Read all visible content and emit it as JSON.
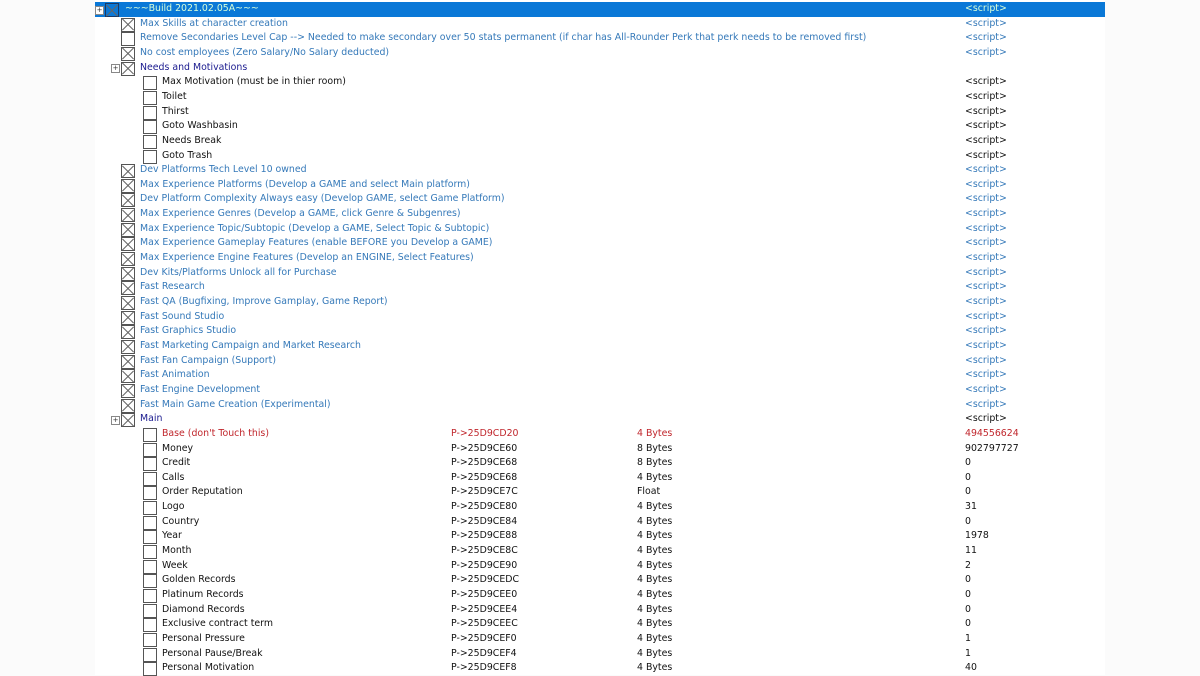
{
  "colors": {
    "selection": "#0a78d7",
    "script": "#3579b9",
    "group": "#1b1b8f",
    "red": "#c0262c"
  },
  "rows": [
    {
      "level": 0,
      "expander": true,
      "checked": true,
      "label": "~~~Build 2021.02.05A~~~",
      "value": "<script>",
      "style": "script",
      "selected": true
    },
    {
      "level": 1,
      "checked": true,
      "label": "Max Skills at character creation",
      "value": "<script>",
      "style": "script"
    },
    {
      "level": 1,
      "checked": false,
      "label": "Remove Secondaries Level Cap --> Needed to make secondary over 50 stats permanent (if char has All-Rounder Perk that perk needs to be removed first)",
      "value": "<script>",
      "style": "script"
    },
    {
      "level": 1,
      "checked": true,
      "label": "No cost employees (Zero Salary/No Salary deducted)",
      "value": "<script>",
      "style": "script"
    },
    {
      "level": 1,
      "expander": true,
      "checked": true,
      "label": "Needs and Motivations",
      "value": "",
      "style": "group"
    },
    {
      "level": 2,
      "checked": false,
      "label": "Max Motivation (must be in thier room)",
      "value": "<script>",
      "style": "plain"
    },
    {
      "level": 2,
      "checked": false,
      "label": "Toilet",
      "value": "<script>",
      "style": "plain"
    },
    {
      "level": 2,
      "checked": false,
      "label": "Thirst",
      "value": "<script>",
      "style": "plain"
    },
    {
      "level": 2,
      "checked": false,
      "label": "Goto Washbasin",
      "value": "<script>",
      "style": "plain"
    },
    {
      "level": 2,
      "checked": false,
      "label": "Needs Break",
      "value": "<script>",
      "style": "plain"
    },
    {
      "level": 2,
      "checked": false,
      "label": "Goto Trash",
      "value": "<script>",
      "style": "plain"
    },
    {
      "level": 1,
      "checked": true,
      "label": "Dev Platforms Tech Level 10 owned",
      "value": "<script>",
      "style": "script"
    },
    {
      "level": 1,
      "checked": true,
      "label": "Max Experience Platforms  (Develop a GAME and select Main platform)",
      "value": "<script>",
      "style": "script"
    },
    {
      "level": 1,
      "checked": true,
      "label": "Dev Platform Complexity Always easy (Develop GAME, select Game Platform)",
      "value": "<script>",
      "style": "script"
    },
    {
      "level": 1,
      "checked": true,
      "label": "Max Experience Genres (Develop a GAME, click Genre & Subgenres)",
      "value": "<script>",
      "style": "script"
    },
    {
      "level": 1,
      "checked": true,
      "label": "Max Experience Topic/Subtopic (Develop a GAME, Select Topic & Subtopic)",
      "value": "<script>",
      "style": "script"
    },
    {
      "level": 1,
      "checked": true,
      "label": "Max Experience Gameplay Features (enable BEFORE you Develop a GAME)",
      "value": "<script>",
      "style": "script"
    },
    {
      "level": 1,
      "checked": true,
      "label": "Max Experience Engine Features (Develop an ENGINE, Select Features)",
      "value": "<script>",
      "style": "script"
    },
    {
      "level": 1,
      "checked": true,
      "label": "Dev Kits/Platforms Unlock all for Purchase",
      "value": "<script>",
      "style": "script"
    },
    {
      "level": 1,
      "checked": true,
      "label": "Fast Research",
      "value": "<script>",
      "style": "script"
    },
    {
      "level": 1,
      "checked": true,
      "label": "Fast QA (Bugfixing, Improve Gamplay, Game Report)",
      "value": "<script>",
      "style": "script"
    },
    {
      "level": 1,
      "checked": true,
      "label": "Fast Sound Studio",
      "value": "<script>",
      "style": "script"
    },
    {
      "level": 1,
      "checked": true,
      "label": "Fast Graphics Studio",
      "value": "<script>",
      "style": "script"
    },
    {
      "level": 1,
      "checked": true,
      "label": "Fast Marketing Campaign and Market Research",
      "value": "<script>",
      "style": "script"
    },
    {
      "level": 1,
      "checked": true,
      "label": "Fast Fan Campaign (Support)",
      "value": "<script>",
      "style": "script"
    },
    {
      "level": 1,
      "checked": true,
      "label": "Fast Animation",
      "value": "<script>",
      "style": "script"
    },
    {
      "level": 1,
      "checked": true,
      "label": "Fast Engine Development",
      "value": "<script>",
      "style": "script"
    },
    {
      "level": 1,
      "checked": true,
      "label": "Fast Main Game Creation (Experimental)",
      "value": "<script>",
      "style": "script"
    },
    {
      "level": 1,
      "expander": true,
      "checked": true,
      "label": "Main",
      "value": "<script>",
      "style": "group"
    },
    {
      "level": 2,
      "checked": false,
      "label": "Base (don't Touch this)",
      "address": "P->25D9CD20",
      "type": "4 Bytes",
      "value": "494556624",
      "style": "red"
    },
    {
      "level": 2,
      "checked": false,
      "label": "Money",
      "address": "P->25D9CE60",
      "type": "8 Bytes",
      "value": "902797727",
      "style": "plain"
    },
    {
      "level": 2,
      "checked": false,
      "label": "Credit",
      "address": "P->25D9CE68",
      "type": "8 Bytes",
      "value": "0",
      "style": "plain"
    },
    {
      "level": 2,
      "checked": false,
      "label": "Calls",
      "address": "P->25D9CE68",
      "type": "4 Bytes",
      "value": "0",
      "style": "plain"
    },
    {
      "level": 2,
      "checked": false,
      "label": "Order Reputation",
      "address": "P->25D9CE7C",
      "type": "Float",
      "value": "0",
      "style": "plain"
    },
    {
      "level": 2,
      "checked": false,
      "label": "Logo",
      "address": "P->25D9CE80",
      "type": "4 Bytes",
      "value": "31",
      "style": "plain"
    },
    {
      "level": 2,
      "checked": false,
      "label": "Country",
      "address": "P->25D9CE84",
      "type": "4 Bytes",
      "value": "0",
      "style": "plain"
    },
    {
      "level": 2,
      "checked": false,
      "label": "Year",
      "address": "P->25D9CE88",
      "type": "4 Bytes",
      "value": "1978",
      "style": "plain"
    },
    {
      "level": 2,
      "checked": false,
      "label": "Month",
      "address": "P->25D9CE8C",
      "type": "4 Bytes",
      "value": "11",
      "style": "plain"
    },
    {
      "level": 2,
      "checked": false,
      "label": "Week",
      "address": "P->25D9CE90",
      "type": "4 Bytes",
      "value": "2",
      "style": "plain"
    },
    {
      "level": 2,
      "checked": false,
      "label": "Golden Records",
      "address": "P->25D9CEDC",
      "type": "4 Bytes",
      "value": "0",
      "style": "plain"
    },
    {
      "level": 2,
      "checked": false,
      "label": "Platinum Records",
      "address": "P->25D9CEE0",
      "type": "4 Bytes",
      "value": "0",
      "style": "plain"
    },
    {
      "level": 2,
      "checked": false,
      "label": "Diamond Records",
      "address": "P->25D9CEE4",
      "type": "4 Bytes",
      "value": "0",
      "style": "plain"
    },
    {
      "level": 2,
      "checked": false,
      "label": "Exclusive contract term",
      "address": "P->25D9CEEC",
      "type": "4 Bytes",
      "value": "0",
      "style": "plain"
    },
    {
      "level": 2,
      "checked": false,
      "label": "Personal Pressure",
      "address": "P->25D9CEF0",
      "type": "4 Bytes",
      "value": "1",
      "style": "plain"
    },
    {
      "level": 2,
      "checked": false,
      "label": "Personal Pause/Break",
      "address": "P->25D9CEF4",
      "type": "4 Bytes",
      "value": "1",
      "style": "plain"
    },
    {
      "level": 2,
      "checked": false,
      "label": "Personal Motivation",
      "address": "P->25D9CEF8",
      "type": "4 Bytes",
      "value": "40",
      "style": "plain"
    }
  ]
}
